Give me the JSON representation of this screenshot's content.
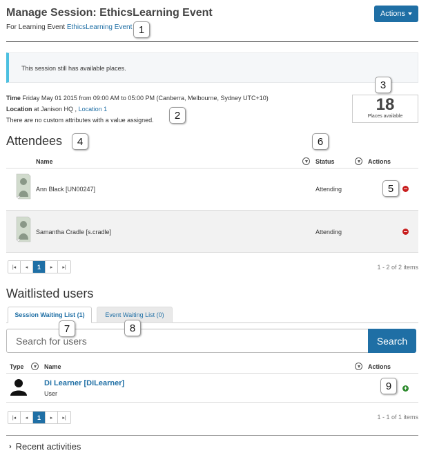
{
  "header": {
    "title": "Manage Session: EthicsLearning Event",
    "subtitle_prefix": "For Learning Event",
    "subtitle_link": "EthicsLearning Event",
    "actions_label": "Actions"
  },
  "alert": {
    "text": "This session still has available places."
  },
  "details": {
    "time_label": "Time",
    "time_value": "Friday May 01 2015 from 09:00 AM to 05:00 PM (Canberra, Melbourne, Sydney UTC+10)",
    "location_label": "Location",
    "location_value": "at Janison HQ ,",
    "location_link": "Location 1",
    "custom_attributes": "There are no custom attributes with a value assigned."
  },
  "places": {
    "count": "18",
    "label": "Places available"
  },
  "attendees": {
    "heading": "Attendees",
    "columns": {
      "name": "Name",
      "status": "Status",
      "actions": "Actions"
    },
    "rows": [
      {
        "name": "Ann Black [UN00247]",
        "status": "Attending"
      },
      {
        "name": "Samantha Cradle [s.cradle]",
        "status": "Attending"
      }
    ],
    "pager": {
      "first": "|◂",
      "prev": "◂",
      "page": "1",
      "next": "▸",
      "last": "▸|"
    },
    "count": "1 - 2 of 2 items"
  },
  "waitlist": {
    "heading": "Waitlisted users",
    "tabs": [
      "Session Waiting List (1)",
      "Event Waiting List (0)"
    ],
    "search_placeholder": "Search for users",
    "search_button": "Search",
    "columns": {
      "type": "Type",
      "name": "Name",
      "actions": "Actions"
    },
    "rows": [
      {
        "name": "Di Learner [DiLearner]",
        "type": "User"
      }
    ],
    "pager": {
      "first": "|◂",
      "prev": "◂",
      "page": "1",
      "next": "▸",
      "last": "▸|"
    },
    "count": "1 - 1 of 1 items"
  },
  "recent": {
    "label": "Recent activities"
  },
  "callouts": [
    "1",
    "2",
    "3",
    "4",
    "5",
    "6",
    "7",
    "8",
    "9"
  ],
  "colors": {
    "primary": "#1f6fa5",
    "remove": "#c81e1e",
    "add": "#2e8b2e",
    "alert_accent": "#4cc0e0"
  }
}
